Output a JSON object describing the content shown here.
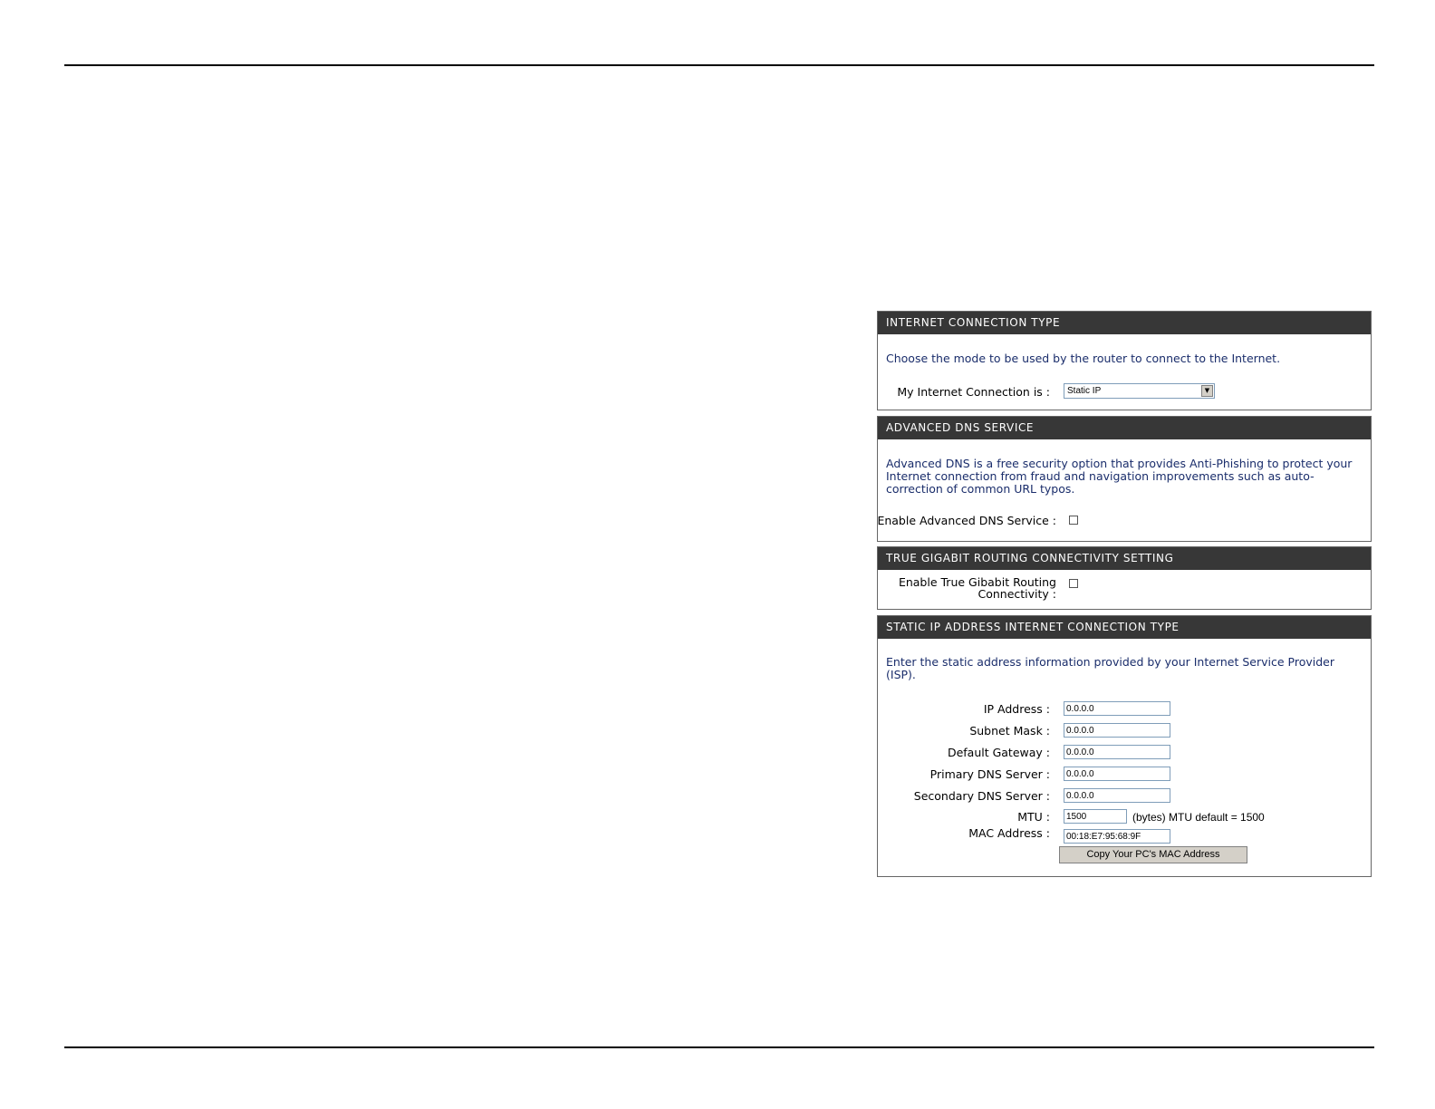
{
  "internet_connection_type": {
    "header": "INTERNET CONNECTION TYPE",
    "description": "Choose the mode to be used by the router to connect to the Internet.",
    "connection_label": "My Internet Connection is :",
    "connection_value": "Static IP"
  },
  "advanced_dns": {
    "header": "ADVANCED DNS SERVICE",
    "description": "Advanced DNS is a free security option that provides Anti-Phishing to protect your Internet connection from fraud and navigation improvements such as auto-correction of common URL typos.",
    "enable_label": "Enable Advanced DNS Service :",
    "enabled": false
  },
  "gigabit_routing": {
    "header": "TRUE GIGABIT ROUTING CONNECTIVITY SETTING",
    "enable_label_line1": "Enable True Gibabit Routing",
    "enable_label_line2": "Connectivity :",
    "enabled": false
  },
  "static_ip": {
    "header": "STATIC IP ADDRESS INTERNET CONNECTION TYPE",
    "description": "Enter the static address information provided by your Internet Service Provider (ISP).",
    "fields": [
      {
        "label": "IP Address :",
        "value": "0.0.0.0"
      },
      {
        "label": "Subnet Mask :",
        "value": "0.0.0.0"
      },
      {
        "label": "Default Gateway :",
        "value": "0.0.0.0"
      },
      {
        "label": "Primary DNS Server :",
        "value": "0.0.0.0"
      },
      {
        "label": "Secondary DNS Server :",
        "value": "0.0.0.0"
      }
    ],
    "mtu_label": "MTU :",
    "mtu_value": "1500",
    "mtu_note": "(bytes) MTU default = 1500",
    "mac_label": "MAC Address :",
    "mac_value": "00:18:E7:95:68:9F",
    "copy_mac_button": "Copy Your PC's MAC Address"
  }
}
